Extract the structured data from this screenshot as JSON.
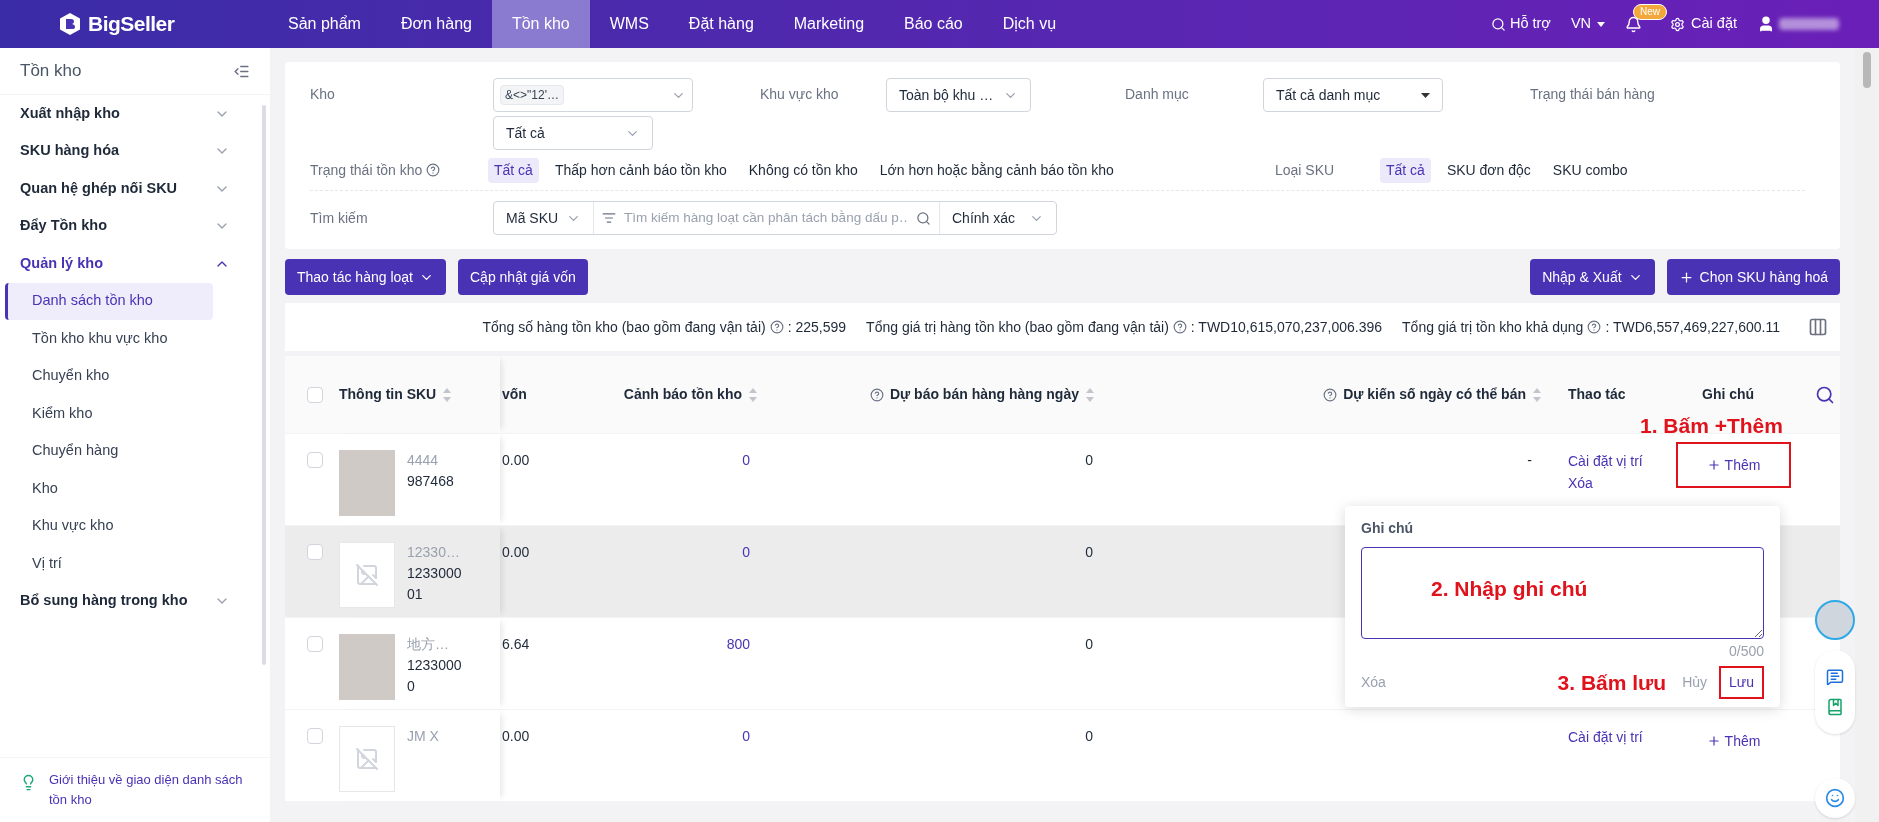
{
  "top_nav": {
    "logo": "BigSeller",
    "items": [
      {
        "label": "Sản phẩm",
        "selected": false
      },
      {
        "label": "Đơn hàng",
        "selected": false
      },
      {
        "label": "Tồn kho",
        "selected": true
      },
      {
        "label": "WMS",
        "selected": false
      },
      {
        "label": "Đặt hàng",
        "selected": false
      },
      {
        "label": "Marketing",
        "selected": false
      },
      {
        "label": "Báo cáo",
        "selected": false
      },
      {
        "label": "Dịch vụ",
        "selected": false
      }
    ],
    "support": "Hỗ trợ",
    "language": "VN",
    "notification_badge": "New",
    "settings": "Cài đặt"
  },
  "sidebar": {
    "title": "Tồn kho",
    "groups": [
      {
        "label": "Xuất nhập kho",
        "expanded": false
      },
      {
        "label": "SKU hàng hóa",
        "expanded": false
      },
      {
        "label": "Quan hệ ghép nối SKU",
        "expanded": false
      },
      {
        "label": "Đẩy Tồn kho",
        "expanded": false
      },
      {
        "label": "Quản lý kho",
        "expanded": true,
        "children": [
          {
            "label": "Danh sách tồn kho",
            "selected": true
          },
          {
            "label": "Tồn kho khu vực kho",
            "selected": false
          },
          {
            "label": "Chuyển kho",
            "selected": false
          },
          {
            "label": "Kiểm kho",
            "selected": false
          },
          {
            "label": "Chuyển hàng",
            "selected": false
          },
          {
            "label": "Kho",
            "selected": false
          },
          {
            "label": "Khu vực kho",
            "selected": false
          },
          {
            "label": "Vị trí",
            "selected": false
          }
        ]
      },
      {
        "label": "Bổ sung hàng trong kho",
        "expanded": false
      }
    ],
    "footer_link": "Giới thiệu về giao diện danh sách tồn kho"
  },
  "filters": {
    "warehouse": {
      "label": "Kho",
      "tag": "&<>\"12'…",
      "select": "Tất cả"
    },
    "zone": {
      "label": "Khu vực kho",
      "value": "Toàn bộ khu …"
    },
    "category": {
      "label": "Danh mục",
      "value": "Tất cả danh mục"
    },
    "sales_status": {
      "label": "Trạng thái bán hàng"
    },
    "stock_status": {
      "label": "Trạng thái tồn kho",
      "options": [
        {
          "label": "Tất cả",
          "selected": true
        },
        {
          "label": "Thấp hơn cảnh báo tồn kho",
          "selected": false
        },
        {
          "label": "Không có tồn kho",
          "selected": false
        },
        {
          "label": "Lớn hơn hoặc bằng cảnh báo tồn kho",
          "selected": false
        }
      ]
    },
    "sku_type": {
      "label": "Loại SKU",
      "options": [
        {
          "label": "Tất cả",
          "selected": true
        },
        {
          "label": "SKU đơn độc",
          "selected": false
        },
        {
          "label": "SKU combo",
          "selected": false
        }
      ]
    },
    "search": {
      "label": "Tìm kiếm",
      "field": "Mã SKU",
      "placeholder": "Tìm kiếm hàng loạt cần phân tách bằng dấu p…",
      "match": "Chính xác"
    }
  },
  "toolbar": {
    "left": [
      {
        "label": "Thao tác hàng loạt",
        "kind": "dropdown"
      },
      {
        "label": "Cập nhật giá vốn",
        "kind": "plain"
      }
    ],
    "right": [
      {
        "label": "Nhập & Xuất",
        "kind": "dropdown"
      },
      {
        "label": "Chọn SKU hàng hoá",
        "kind": "add"
      }
    ]
  },
  "summary": [
    {
      "label": "Tổng số hàng tồn kho (bao gồm đang vận tải)",
      "value": ": 225,599"
    },
    {
      "label": "Tổng giá trị hàng tồn kho (bao gồm đang vận tải)",
      "value": ": TWD10,615,070,237,006.396"
    },
    {
      "label": "Tổng giá trị tồn kho khả dụng",
      "value": ": TWD6,557,469,227,600.11"
    }
  ],
  "table": {
    "select_all": {
      "checked": false
    },
    "columns": [
      {
        "label": "Thông tin SKU",
        "sortable": true,
        "help": false
      },
      {
        "label": "vốn",
        "sortable": false,
        "help": false
      },
      {
        "label": "Cảnh báo tồn kho",
        "sortable": true,
        "help": false
      },
      {
        "label": "Dự báo bán hàng hàng ngày",
        "sortable": true,
        "help": true
      },
      {
        "label": "Dự kiến số ngày có thể bán",
        "sortable": true,
        "help": true
      },
      {
        "label": "Thao tác",
        "sortable": false,
        "help": false
      },
      {
        "label": "Ghi chú",
        "sortable": false,
        "help": false
      }
    ],
    "rows": [
      {
        "checked": false,
        "hovered": false,
        "kind": "photo",
        "sku_name": "4444",
        "sku_code": "987468",
        "cost": "0.00",
        "stock_warning": "0",
        "daily_forecast": "0",
        "days_sellable": "-",
        "actions": [
          "Cài đặt vị trí",
          "Xóa"
        ],
        "note_button": "Thêm",
        "note_highlighted": true
      },
      {
        "checked": false,
        "hovered": true,
        "kind": "no_image",
        "sku_name": "12330…",
        "sku_code": "123300001",
        "cost": "0.00",
        "stock_warning": "0",
        "daily_forecast": "0"
      },
      {
        "checked": false,
        "hovered": false,
        "kind": "photo",
        "sku_name": "地方…",
        "sku_code": "12330000",
        "cost": "6.64",
        "stock_warning": "800",
        "daily_forecast": "0"
      },
      {
        "checked": false,
        "hovered": false,
        "kind": "no_image",
        "sku_name": "JM X",
        "cost": "0.00",
        "stock_warning": "0",
        "daily_forecast": "0",
        "actions": [
          "Cài đặt vị trí"
        ],
        "note_button": "Thêm",
        "note_highlighted": false
      }
    ]
  },
  "note_popover": {
    "title": "Ghi chú",
    "counter": "0/500",
    "delete": "Xóa",
    "cancel": "Hủy",
    "save": "Lưu",
    "save_highlighted": true
  },
  "annotations": [
    "1. Bấm +Thêm",
    "2. Nhập ghi chú",
    "3. Bấm lưu"
  ]
}
